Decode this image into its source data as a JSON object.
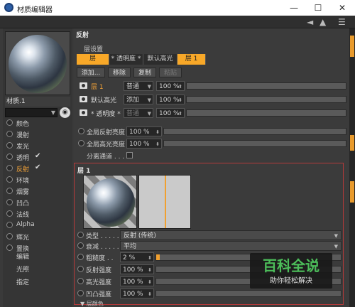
{
  "window": {
    "title": "材质编辑器",
    "minimize_glyph": "—",
    "maximize_glyph": "☐",
    "close_glyph": "✕"
  },
  "menubar": {
    "nav_back_glyph": "◄",
    "nav_forward_glyph": "▲",
    "view_menu_glyph": "☰"
  },
  "left": {
    "material_name": "材质.1",
    "channels": [
      {
        "label": "颜色",
        "checked": false,
        "active": false
      },
      {
        "label": "漫射",
        "checked": false,
        "active": false
      },
      {
        "label": "发光",
        "checked": false,
        "active": false
      },
      {
        "label": "透明",
        "checked": true,
        "active": false
      },
      {
        "label": "反射",
        "checked": true,
        "active": true
      },
      {
        "label": "环境",
        "checked": false,
        "active": false
      },
      {
        "label": "烟雾",
        "checked": false,
        "active": false
      },
      {
        "label": "凹凸",
        "checked": false,
        "active": false
      },
      {
        "label": "法线",
        "checked": false,
        "active": false
      },
      {
        "label": "Alpha",
        "checked": false,
        "active": false
      },
      {
        "label": "辉光",
        "checked": false,
        "active": false
      },
      {
        "label": "置换",
        "checked": false,
        "active": false
      }
    ],
    "extra_items": [
      "编辑",
      "光照",
      "指定"
    ],
    "check_glyph": "✔",
    "accent": "#f2a237"
  },
  "reflect": {
    "title": "反射",
    "layer_settings": "层设置",
    "tabs": [
      "层",
      "* 透明度 *",
      "默认高光",
      "层 1"
    ],
    "buttons": {
      "add": "添加...",
      "remove": "移除",
      "copy": "复制",
      "paste": "粘贴"
    },
    "layers": [
      {
        "name": "层 1",
        "mode": "普通",
        "percent": "100 %"
      },
      {
        "name": "默认高光",
        "mode": "添加",
        "percent": "100 %"
      },
      {
        "name": "* 透明度 *",
        "mode": "普通",
        "percent": "100 %"
      }
    ],
    "global_reflect": {
      "label": "全局反射亮度",
      "value": "100 %"
    },
    "global_spec": {
      "label": "全局高光亮度",
      "value": "100 %"
    },
    "separate_pass": {
      "label": "分离通道 . . . . ."
    }
  },
  "layer1": {
    "title": "层 1",
    "type": {
      "label": "类型 . . . . . .",
      "value": "反射 (传统)"
    },
    "attenuation": {
      "label": "衰减 . . . . . .",
      "value": "平均"
    },
    "roughness": {
      "label": "粗糙度 . .",
      "value": "2 %",
      "fraction": 0.02
    },
    "reflect_strength": {
      "label": "反射强度",
      "value": "100 %"
    },
    "spec_strength": {
      "label": "高光强度",
      "value": "100 %"
    },
    "bump_strength": {
      "label": "凹凸强度",
      "value": "100 %"
    },
    "layer_color": "▼ 层颜色"
  },
  "watermark": {
    "main": "百科全说",
    "sub": "助你轻松解决"
  },
  "colors": {
    "accent": "#f8a828",
    "panel_border": "#b33a3a"
  }
}
